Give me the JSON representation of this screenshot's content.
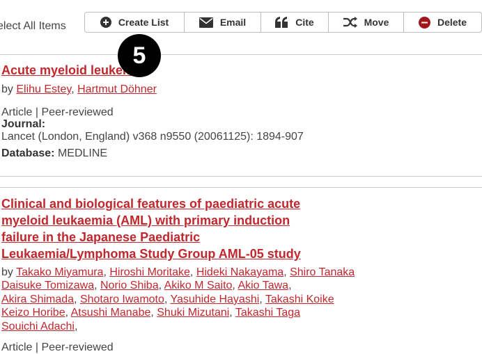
{
  "header": {
    "select_all": "elect All Items"
  },
  "toolbar": {
    "create_list": "Create List",
    "email": "Email",
    "cite": "Cite",
    "move": "Move",
    "delete": "Delete"
  },
  "badge": "5",
  "results": [
    {
      "title": "Acute myeloid leukemia.",
      "by": "by",
      "authors": [
        "Elihu Estey",
        "Hartmut Döhner"
      ],
      "type": "Article | Peer-reviewed",
      "journal_label": "Journal:",
      "journal": "Lancet (London, England) v368 n9550 (20061125): 1894-907",
      "database_label": "Database:",
      "database": "MEDLINE"
    },
    {
      "title_lines": [
        "Clinical and biological features of paediatric acute",
        "myeloid leukaemia (AML) with primary induction",
        "failure in the Japanese Paediatric",
        "Leukaemia/Lymphoma Study Group AML-05 study"
      ],
      "by": "by",
      "authors": [
        "Takako Miyamura",
        "Hiroshi Moritake",
        "Hideki Nakayama",
        "Shiro Tanaka",
        "Daisuke Tomizawa",
        "Norio Shiba",
        "Akiko M Saito",
        "Akio Tawa",
        "Akira Shimada",
        "Shotaro Iwamoto",
        "Yasuhide Hayashi",
        "Takashi Koike",
        "Keizo Horibe",
        "Atsushi Manabe",
        "Shuki Mizutani",
        "Takashi Taga",
        "Souichi Adachi"
      ],
      "type": "Article | Peer-reviewed"
    }
  ],
  "colors": {
    "link": "#c1272d",
    "delete_icon": "#a3161b"
  }
}
